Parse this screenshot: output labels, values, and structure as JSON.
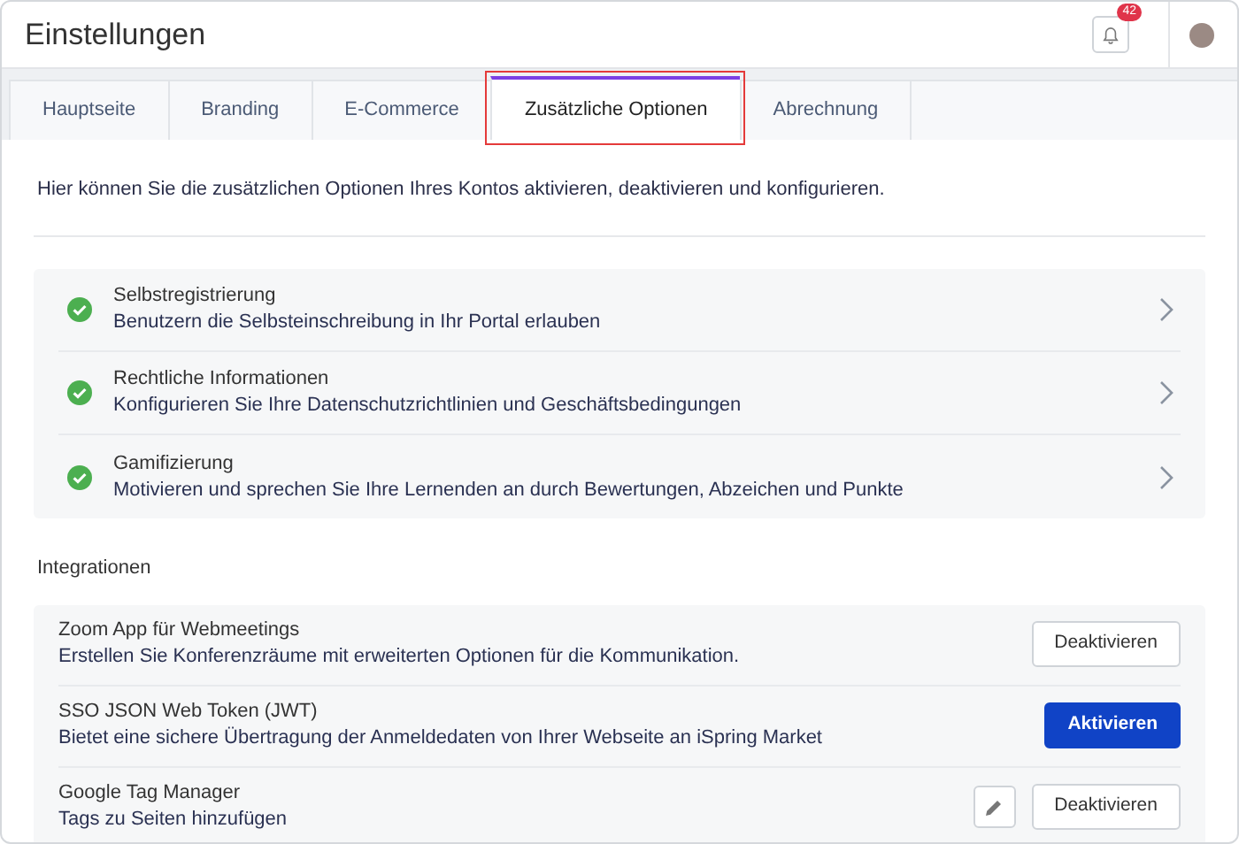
{
  "header": {
    "title": "Einstellungen",
    "notification_count": "42"
  },
  "tabs": [
    {
      "label": "Hauptseite",
      "selected": false
    },
    {
      "label": "Branding",
      "selected": false
    },
    {
      "label": "E-Commerce",
      "selected": false
    },
    {
      "label": "Zusätzliche Optionen",
      "selected": true
    },
    {
      "label": "Abrechnung",
      "selected": false
    }
  ],
  "intro": "Hier können Sie die zusätzlichen Optionen Ihres Kontos aktivieren, deaktivieren und konfigurieren.",
  "options": [
    {
      "title": "Selbstregistrierung",
      "description": "Benutzern die Selbsteinschreibung in Ihr Portal erlauben",
      "enabled": true
    },
    {
      "title": "Rechtliche Informationen",
      "description": "Konfigurieren Sie Ihre Datenschutzrichtlinien und Geschäftsbedingungen",
      "enabled": true
    },
    {
      "title": "Gamifizierung",
      "description": "Motivieren und sprechen Sie Ihre Lernenden an durch Bewertungen, Abzeichen und Punkte",
      "enabled": true
    }
  ],
  "integrations_heading": "Integrationen",
  "integrations": [
    {
      "title": "Zoom App für Webmeetings",
      "description": "Erstellen Sie Konferenzräume mit erweiterten Optionen für die Kommunikation.",
      "editable": false,
      "button": {
        "label": "Deaktivieren",
        "kind": "outline"
      }
    },
    {
      "title": "SSO JSON Web Token (JWT)",
      "description": "Bietet eine sichere Übertragung der Anmeldedaten von Ihrer Webseite an iSpring Market",
      "editable": false,
      "button": {
        "label": "Aktivieren",
        "kind": "primary"
      }
    },
    {
      "title": "Google Tag Manager",
      "description": "Tags zu Seiten hinzufügen",
      "editable": true,
      "button": {
        "label": "Deaktivieren",
        "kind": "outline"
      }
    }
  ]
}
